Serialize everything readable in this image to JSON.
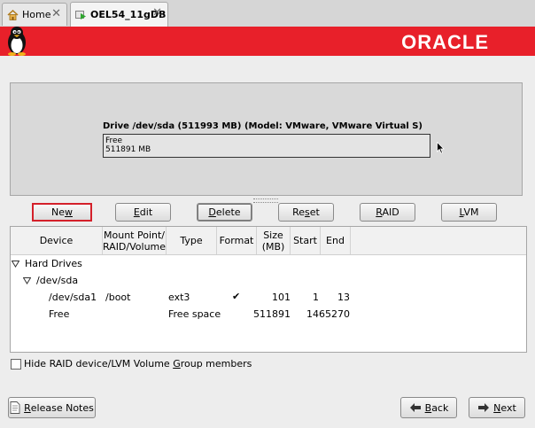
{
  "tabs": [
    {
      "label": "Home",
      "close": "✕"
    },
    {
      "label": "OEL54_11gDB",
      "close": "✕"
    }
  ],
  "brand": {
    "logo_text": "ORACLE",
    "color": "#e8202a"
  },
  "drive": {
    "title": "Drive /dev/sda (511993 MB) (Model: VMware, VMware Virtual S)",
    "free_label": "Free",
    "free_size": "511891 MB"
  },
  "buttons": {
    "new": {
      "pre": "Ne",
      "u": "w",
      "post": ""
    },
    "edit": {
      "pre": "",
      "u": "E",
      "post": "dit"
    },
    "delete": {
      "pre": "",
      "u": "D",
      "post": "elete"
    },
    "reset": {
      "pre": "Re",
      "u": "s",
      "post": "et"
    },
    "raid": {
      "pre": "",
      "u": "R",
      "post": "AID"
    },
    "lvm": {
      "pre": "",
      "u": "L",
      "post": "VM"
    }
  },
  "columns": {
    "device": "Device",
    "mount_1": "Mount Point/",
    "mount_2": "RAID/Volume",
    "type": "Type",
    "format": "Format",
    "size_1": "Size",
    "size_2": "(MB)",
    "start": "Start",
    "end": "End"
  },
  "rows": {
    "hard_drives": "Hard Drives",
    "sda": "/dev/sda",
    "sda1": {
      "device": "/dev/sda1",
      "mount": "/boot",
      "type": "ext3",
      "format": "✔",
      "size": "101",
      "start": "1",
      "end": "13"
    },
    "free": {
      "device": "Free",
      "mount": "",
      "type": "Free space",
      "format": "",
      "size": "511891",
      "start": "14",
      "end": "65270"
    }
  },
  "hide_raid": {
    "pre": "Hide RAID device/LVM Volume ",
    "u": "G",
    "post": "roup members",
    "checked": false
  },
  "footer": {
    "release_notes": {
      "pre": "",
      "u": "R",
      "post": "elease Notes"
    },
    "back": {
      "pre": "",
      "u": "B",
      "post": "ack"
    },
    "next": {
      "pre": "",
      "u": "N",
      "post": "ext"
    }
  }
}
